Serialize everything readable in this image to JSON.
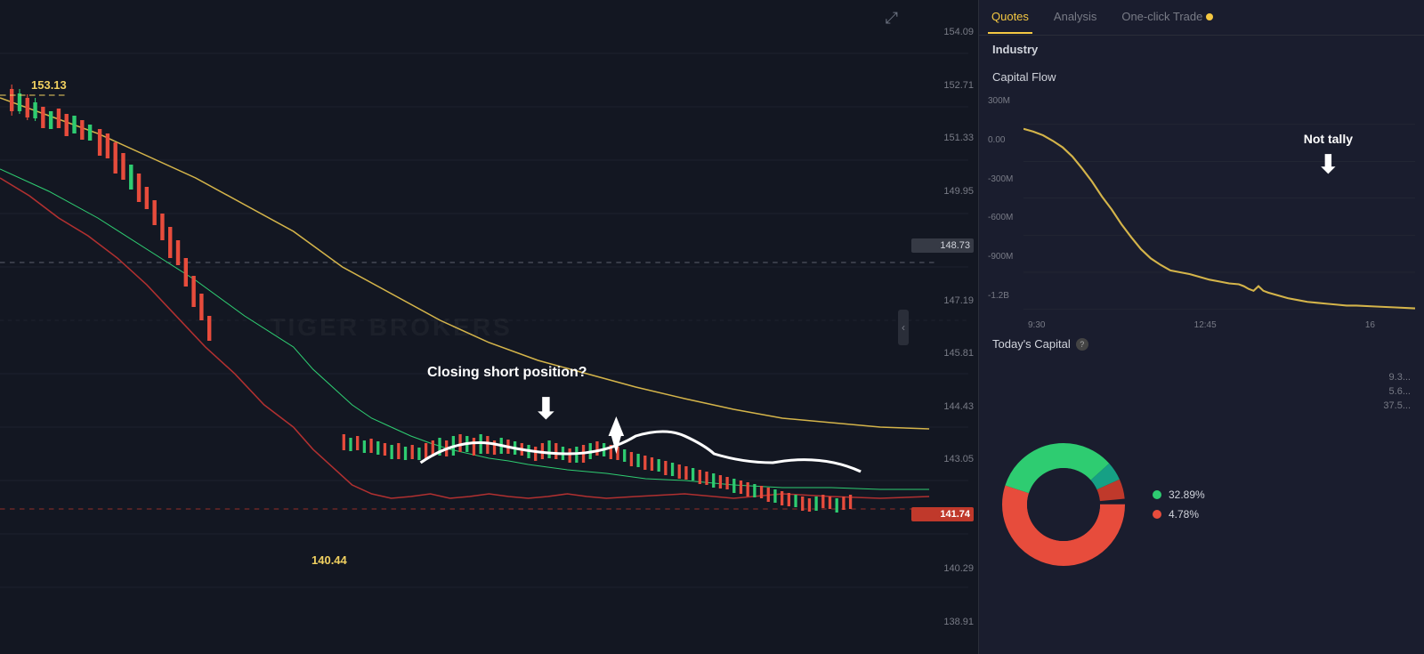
{
  "chart": {
    "watermark": "TIGER BROKERS",
    "expand_icon": "⤢",
    "collapse_icon": "‹",
    "annotations": {
      "closing_short": "Closing short position?",
      "arrow_down": "⬇",
      "not_tally": "Not tally"
    },
    "yellow_labels": [
      {
        "value": "153.13",
        "top": "100",
        "left": "60"
      },
      {
        "value": "140.44",
        "top": "625",
        "left": "355"
      }
    ],
    "price_axis": [
      {
        "value": "154.09",
        "type": "normal"
      },
      {
        "value": "152.71",
        "type": "normal"
      },
      {
        "value": "151.33",
        "type": "normal"
      },
      {
        "value": "149.95",
        "type": "normal"
      },
      {
        "value": "148.73",
        "type": "current"
      },
      {
        "value": "147.19",
        "type": "normal"
      },
      {
        "value": "145.81",
        "type": "normal"
      },
      {
        "value": "144.43",
        "type": "normal"
      },
      {
        "value": "143.05",
        "type": "normal"
      },
      {
        "value": "141.74",
        "type": "current-red"
      },
      {
        "value": "140.29",
        "type": "normal"
      },
      {
        "value": "138.91",
        "type": "normal"
      }
    ]
  },
  "right_panel": {
    "tabs": [
      {
        "label": "Quotes",
        "active": true
      },
      {
        "label": "Analysis",
        "active": false
      },
      {
        "label": "One-click Trade",
        "active": false,
        "badge": true
      }
    ],
    "sub_header": "Industry",
    "capital_flow": {
      "title": "Capital Flow",
      "y_labels": [
        "300M",
        "0.00",
        "-300M",
        "-600M",
        "-900M",
        "-1.2B"
      ],
      "x_labels": [
        "9:30",
        "12:45",
        "16"
      ],
      "not_tally": "Not tally"
    },
    "todays_capital": {
      "title": "Today's Capital",
      "help": "?",
      "legend": [
        {
          "color": "#2ecc71",
          "pct": "32.89%",
          "label": ""
        },
        {
          "color": "#e74c3c",
          "pct": "4.78%",
          "label": ""
        }
      ],
      "right_numbers": [
        "9.3...",
        "5.6...",
        "37.5..."
      ]
    }
  }
}
